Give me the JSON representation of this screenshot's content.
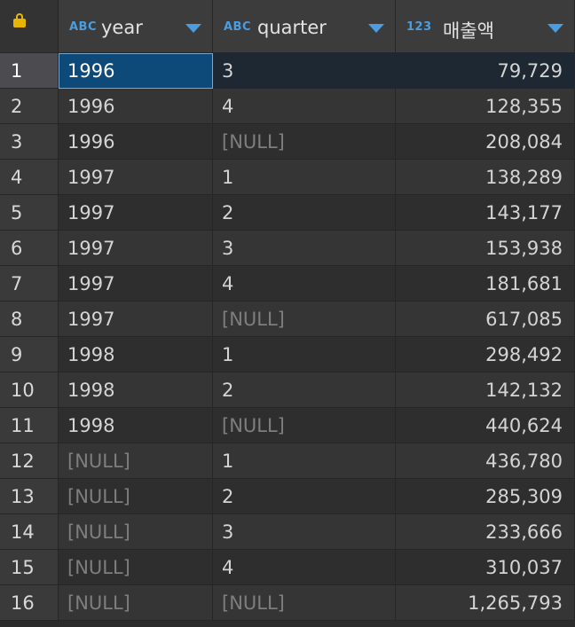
{
  "columns": {
    "year": {
      "type_icon": "ABC",
      "label": "year"
    },
    "quarter": {
      "type_icon": "ABC",
      "label": "quarter"
    },
    "sales": {
      "type_icon": "123",
      "label": "매출액"
    }
  },
  "icons": {
    "corner": "lock-icon",
    "sort": "chevron-down-icon"
  },
  "colors": {
    "accent": "#4a9de0",
    "lock": "#e8b500",
    "selection": "#0d4a7a"
  },
  "selected_row": 1,
  "rows": [
    {
      "num": "1",
      "year": "1996",
      "quarter": "3",
      "sales": "79,729"
    },
    {
      "num": "2",
      "year": "1996",
      "quarter": "4",
      "sales": "128,355"
    },
    {
      "num": "3",
      "year": "1996",
      "quarter": "[NULL]",
      "sales": "208,084"
    },
    {
      "num": "4",
      "year": "1997",
      "quarter": "1",
      "sales": "138,289"
    },
    {
      "num": "5",
      "year": "1997",
      "quarter": "2",
      "sales": "143,177"
    },
    {
      "num": "6",
      "year": "1997",
      "quarter": "3",
      "sales": "153,938"
    },
    {
      "num": "7",
      "year": "1997",
      "quarter": "4",
      "sales": "181,681"
    },
    {
      "num": "8",
      "year": "1997",
      "quarter": "[NULL]",
      "sales": "617,085"
    },
    {
      "num": "9",
      "year": "1998",
      "quarter": "1",
      "sales": "298,492"
    },
    {
      "num": "10",
      "year": "1998",
      "quarter": "2",
      "sales": "142,132"
    },
    {
      "num": "11",
      "year": "1998",
      "quarter": "[NULL]",
      "sales": "440,624"
    },
    {
      "num": "12",
      "year": "[NULL]",
      "quarter": "1",
      "sales": "436,780"
    },
    {
      "num": "13",
      "year": "[NULL]",
      "quarter": "2",
      "sales": "285,309"
    },
    {
      "num": "14",
      "year": "[NULL]",
      "quarter": "3",
      "sales": "233,666"
    },
    {
      "num": "15",
      "year": "[NULL]",
      "quarter": "4",
      "sales": "310,037"
    },
    {
      "num": "16",
      "year": "[NULL]",
      "quarter": "[NULL]",
      "sales": "1,265,793"
    }
  ]
}
